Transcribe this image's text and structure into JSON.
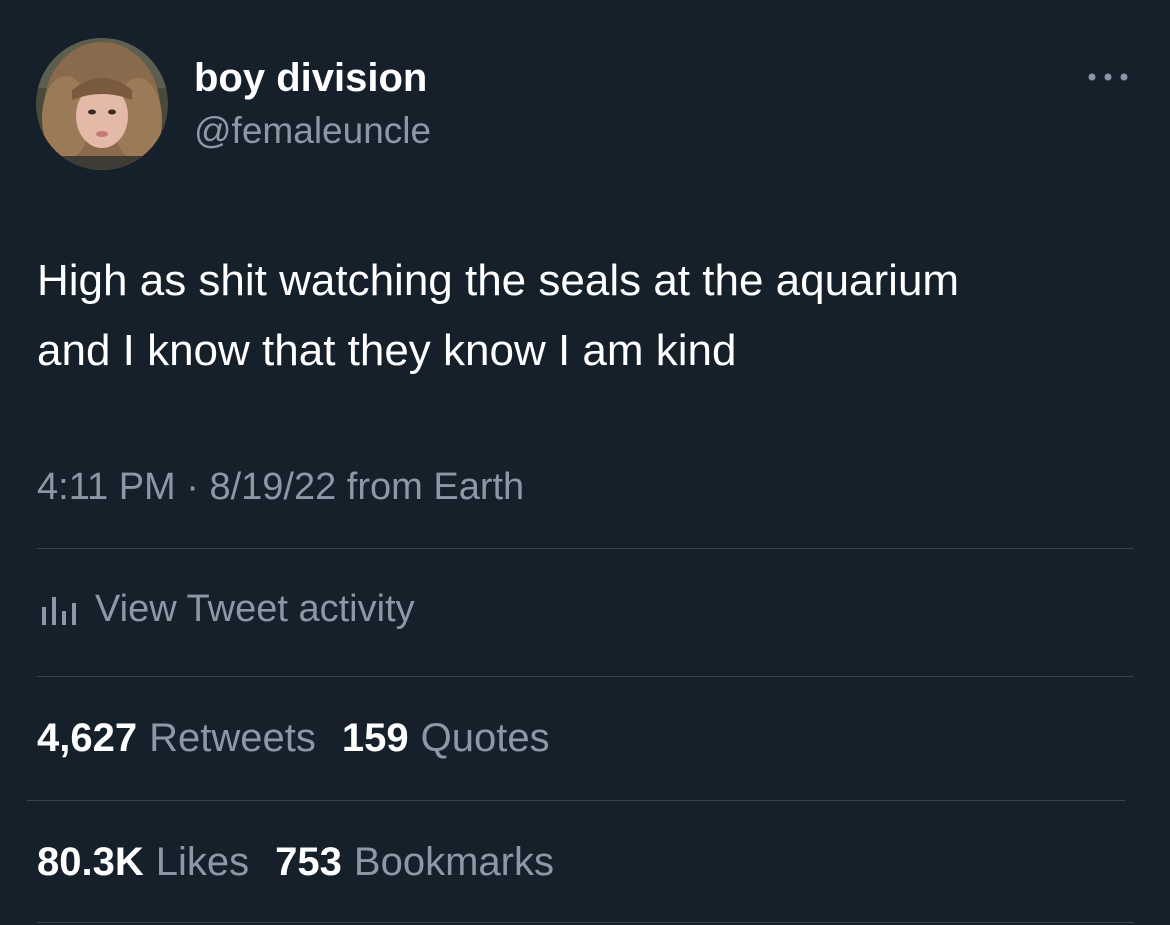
{
  "author": {
    "display_name": "boy division",
    "handle": "@femaleuncle"
  },
  "tweet": {
    "text_lines": [
      "High as shit watching the seals at the aquarium",
      "and I know that they know I am kind"
    ],
    "meta": "4:11 PM · 8/19/22 from Earth"
  },
  "activity": {
    "label": "View Tweet activity"
  },
  "stats": {
    "retweets_count": "4,627",
    "retweets_label": "Retweets",
    "quotes_count": "159",
    "quotes_label": "Quotes",
    "likes_count": "80.3K",
    "likes_label": "Likes",
    "bookmarks_count": "753",
    "bookmarks_label": "Bookmarks"
  },
  "icons": {
    "more": "more-horizontal-icon",
    "activity": "bar-chart-icon"
  },
  "colors": {
    "background": "#15202b",
    "primary_text": "#ffffff",
    "secondary_text": "#8b98a5",
    "divider": "#38444d"
  }
}
